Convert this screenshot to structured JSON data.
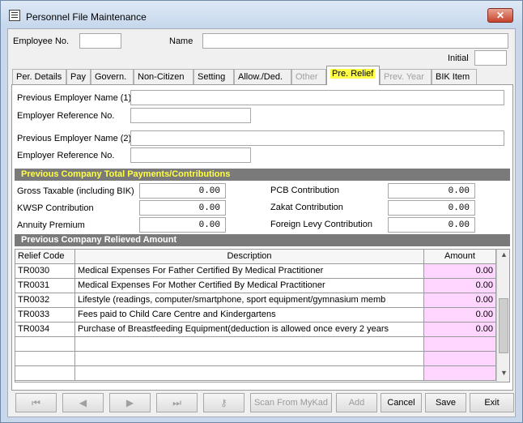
{
  "window": {
    "title": "Personnel File Maintenance",
    "close_glyph": "✕"
  },
  "header": {
    "employee_no_label": "Employee No.",
    "employee_no_value": "",
    "name_label": "Name",
    "name_value": "",
    "initial_label": "Initial",
    "initial_value": ""
  },
  "tabs": [
    {
      "label": "Per. Details",
      "state": "normal"
    },
    {
      "label": "Pay",
      "state": "normal"
    },
    {
      "label": "Govern.",
      "state": "normal"
    },
    {
      "label": "Non-Citizen",
      "state": "normal"
    },
    {
      "label": "Setting",
      "state": "normal"
    },
    {
      "label": "Allow./Ded.",
      "state": "normal"
    },
    {
      "label": "Other",
      "state": "disabled"
    },
    {
      "label": "Pre. Relief",
      "state": "active"
    },
    {
      "label": "Prev. Year",
      "state": "disabled"
    },
    {
      "label": "BIK Item",
      "state": "normal"
    }
  ],
  "employer": {
    "prev_name1_label": "Previous Employer Name (1)",
    "ref1_label": "Employer Reference No.",
    "prev_name2_label": "Previous Employer Name (2)",
    "ref2_label": "Employer Reference No."
  },
  "totals": {
    "section_title": "Previous Company Total Payments/Contributions",
    "gross_label": "Gross Taxable (including BIK)",
    "gross_value": "0.00",
    "kwsp_label": "KWSP Contribution",
    "kwsp_value": "0.00",
    "annuity_label": "Annuity Premium",
    "annuity_value": "0.00",
    "pcb_label": "PCB Contribution",
    "pcb_value": "0.00",
    "zakat_label": "Zakat Contribution",
    "zakat_value": "0.00",
    "levy_label": "Foreign Levy Contribution",
    "levy_value": "0.00"
  },
  "relieved": {
    "section_title": "Previous Company Relieved Amount",
    "columns": [
      "Relief Code",
      "Description",
      "Amount"
    ],
    "rows": [
      {
        "code": "TR0030",
        "desc": "Medical Expenses For Father Certified By Medical Practitioner",
        "amount": "0.00"
      },
      {
        "code": "TR0031",
        "desc": "Medical Expenses For Mother Certified By Medical Practitioner",
        "amount": "0.00"
      },
      {
        "code": "TR0032",
        "desc": "Lifestyle (readings, computer/smartphone, sport equipment/gymnasium memb",
        "amount": "0.00"
      },
      {
        "code": "TR0033",
        "desc": "Fees paid to Child Care Centre and Kindergartens",
        "amount": "0.00"
      },
      {
        "code": "TR0034",
        "desc": "Purchase of Breastfeeding Equipment(deduction is allowed once every 2 years",
        "amount": "0.00"
      }
    ]
  },
  "toolbar": {
    "first_icon": "first-record-icon",
    "prev_icon": "previous-record-icon",
    "next_icon": "next-record-icon",
    "last_icon": "last-record-icon",
    "search_icon": "key-search-icon",
    "scan_label": "Scan From MyKad",
    "add_label": "Add",
    "cancel_label": "Cancel",
    "save_label": "Save",
    "exit_label": "Exit"
  },
  "colors": {
    "highlight": "#ffff44",
    "amount_bg": "#ffd6ff",
    "section_bg": "#7a7a7a"
  }
}
